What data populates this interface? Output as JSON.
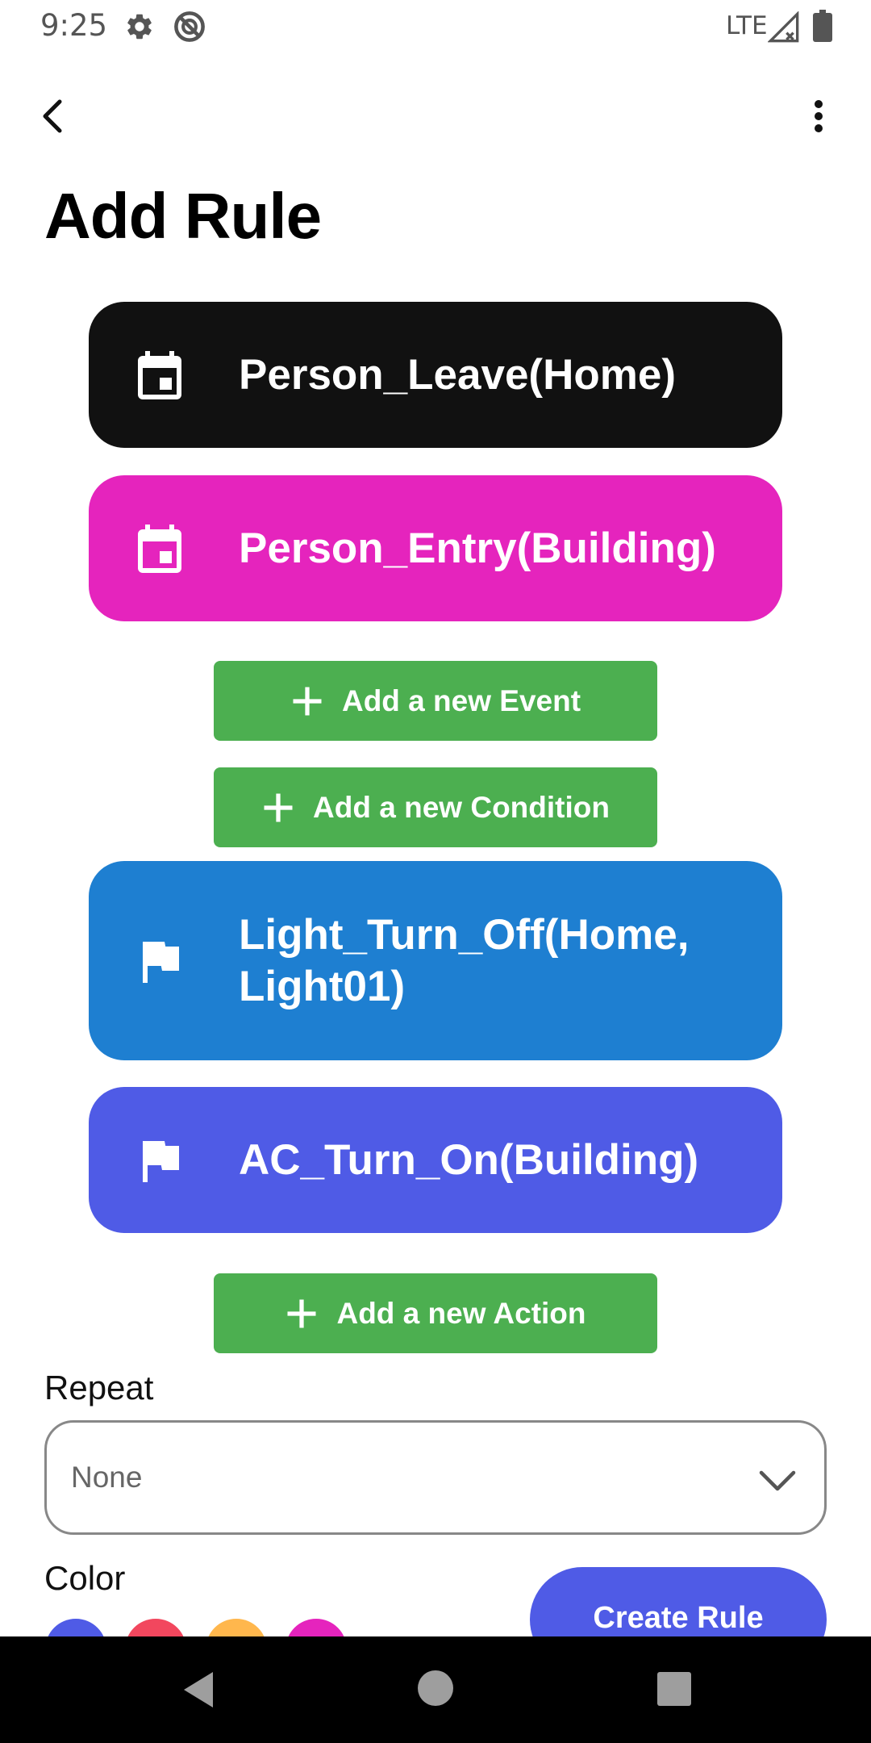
{
  "status_bar": {
    "time": "9:25",
    "network": "LTE",
    "icons": [
      "gear-icon",
      "do-not-disturb-icon",
      "signal-icon",
      "battery-icon"
    ]
  },
  "app_bar": {
    "back_icon": "back-arrow-icon",
    "more_icon": "more-vert-icon"
  },
  "page": {
    "title": "Add Rule"
  },
  "events": [
    {
      "label": "Person_Leave(Home)",
      "icon": "calendar-icon",
      "color": "#111111"
    },
    {
      "label": "Person_Entry(Building)",
      "icon": "calendar-icon",
      "color": "#e524bd"
    }
  ],
  "buttons": {
    "add_event": "Add a new Event",
    "add_condition": "Add a new Condition",
    "add_action": "Add a new Action",
    "create_rule": "Create Rule"
  },
  "actions": [
    {
      "label": "Light_Turn_Off(Home, Light01)",
      "icon": "flag-icon",
      "color": "#1e7fd1"
    },
    {
      "label": "AC_Turn_On(Building)",
      "icon": "flag-icon",
      "color": "#4f5be6"
    }
  ],
  "repeat": {
    "label": "Repeat",
    "value": "None"
  },
  "color": {
    "label": "Color",
    "swatches": [
      "#4f5be6",
      "#f2475e",
      "#ffb74d",
      "#e524bd"
    ]
  },
  "colors": {
    "add_button": "#4caf50",
    "primary": "#4f5be6"
  }
}
